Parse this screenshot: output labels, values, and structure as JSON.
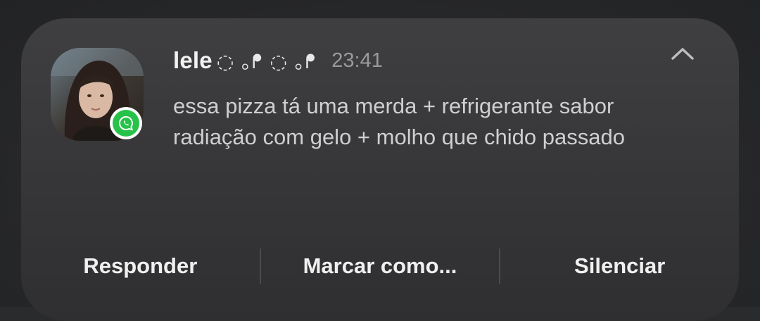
{
  "notification": {
    "sender": "lele",
    "sender_decoration": "◌ ｡ᖰ ◌ ｡ᖰ",
    "time": "23:41",
    "message": "essa pizza tá uma merda + refrigerante sabor radiação com gelo + molho que chido passado",
    "app_icon": "whatsapp-icon",
    "collapse_icon": "chevron-up-icon"
  },
  "actions": {
    "reply_label": "Responder",
    "mark_label": "Marcar como...",
    "mute_label": "Silenciar"
  },
  "colors": {
    "card_background": "#3a3a3c",
    "whatsapp_green": "#27c24a",
    "primary_text": "#f2f2f2",
    "secondary_text": "#9a9a9c"
  }
}
